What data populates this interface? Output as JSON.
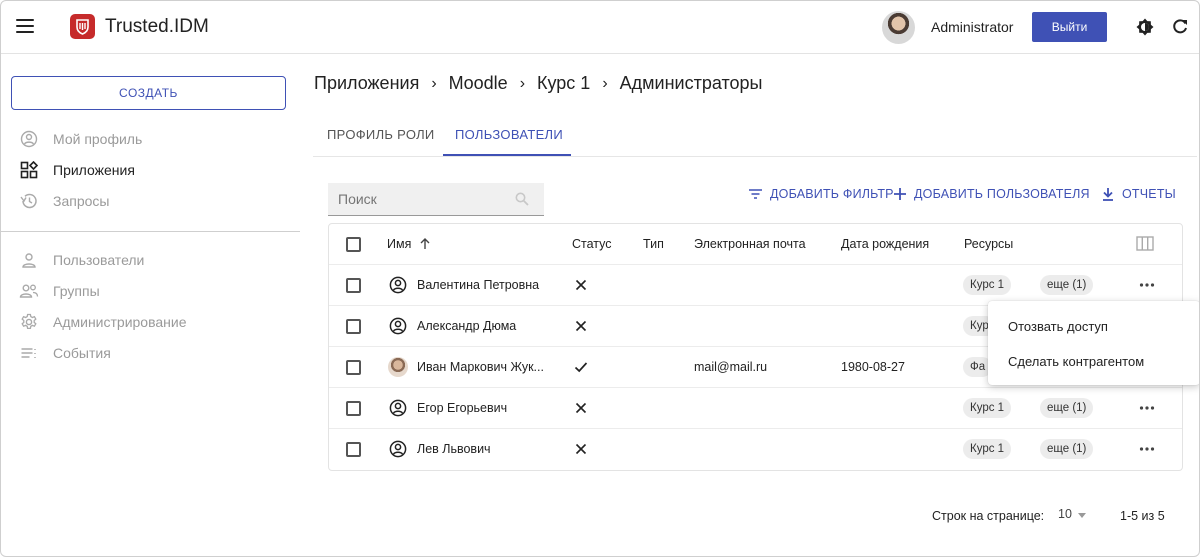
{
  "header": {
    "brand": "Trusted.IDM",
    "user_name": "Administrator",
    "logout_label": "Выйти",
    "accent_color": "#3f51b5",
    "logo_color": "#c62b2b"
  },
  "sidebar": {
    "create_label": "СОЗДАТЬ",
    "items": [
      {
        "label": "Мой профиль",
        "icon": "account-circle-icon",
        "active": false
      },
      {
        "label": "Приложения",
        "icon": "apps-grid-icon",
        "active": true
      },
      {
        "label": "Запросы",
        "icon": "history-icon",
        "active": false
      },
      {
        "label": "Пользователи",
        "icon": "person-icon",
        "active": false
      },
      {
        "label": "Группы",
        "icon": "group-icon",
        "active": false
      },
      {
        "label": "Администрирование",
        "icon": "gear-icon",
        "active": false
      },
      {
        "label": "События",
        "icon": "list-icon",
        "active": false
      }
    ]
  },
  "breadcrumb": [
    "Приложения",
    "Moodle",
    "Курс 1",
    "Администраторы"
  ],
  "tabs": [
    {
      "label": "ПРОФИЛЬ РОЛИ",
      "active": false
    },
    {
      "label": "ПОЛЬЗОВАТЕЛИ",
      "active": true
    }
  ],
  "toolbar": {
    "search_placeholder": "Поиск",
    "add_filter": "ДОБАВИТЬ ФИЛЬТР",
    "add_user": "ДОБАВИТЬ ПОЛЬЗОВАТЕЛЯ",
    "reports": "ОТЧЕТЫ"
  },
  "table": {
    "columns": [
      "Имя",
      "Статус",
      "Тип",
      "Электронная почта",
      "Дата рождения",
      "Ресурсы"
    ],
    "rows": [
      {
        "name": "Валентина Петровна",
        "status": "inactive",
        "type": "",
        "email": "",
        "birth": "",
        "resource": "Курс 1",
        "more": "еще (1)"
      },
      {
        "name": "Александр Дюма",
        "status": "inactive",
        "type": "",
        "email": "",
        "birth": "",
        "resource": "Кур",
        "more": ""
      },
      {
        "name": "Иван Маркович Жук...",
        "status": "active",
        "type": "",
        "email": "mail@mail.ru",
        "birth": "1980-08-27",
        "resource": "Фа",
        "more": ""
      },
      {
        "name": "Егор Егорьевич",
        "status": "inactive",
        "type": "",
        "email": "",
        "birth": "",
        "resource": "Курс 1",
        "more": "еще (1)"
      },
      {
        "name": "Лев Львович",
        "status": "inactive",
        "type": "",
        "email": "",
        "birth": "",
        "resource": "Курс 1",
        "more": "еще (1)"
      }
    ]
  },
  "context_menu": {
    "items": [
      "Отозвать доступ",
      "Сделать контрагентом"
    ]
  },
  "pagination": {
    "rows_label": "Строк на странице:",
    "rows_per_page": "10",
    "range": "1-5 из 5"
  }
}
